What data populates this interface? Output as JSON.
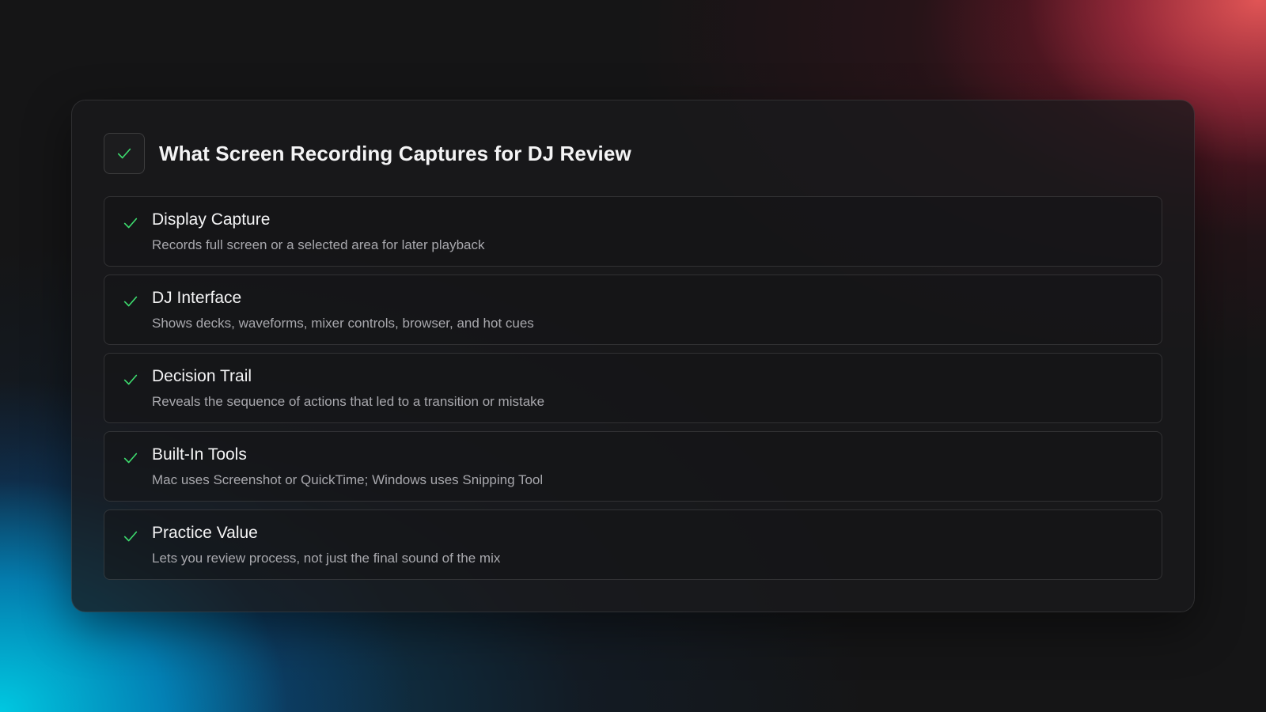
{
  "card": {
    "title": "What Screen Recording Captures for DJ Review",
    "header_icon": "check-icon",
    "accent_color": "#3ddc6e"
  },
  "items": [
    {
      "title": "Display Capture",
      "description": "Records full screen or a selected area for later playback",
      "icon": "check-icon"
    },
    {
      "title": "DJ Interface",
      "description": "Shows decks, waveforms, mixer controls, browser, and hot cues",
      "icon": "check-icon"
    },
    {
      "title": "Decision Trail",
      "description": "Reveals the sequence of actions that led to a transition or mistake",
      "icon": "check-icon"
    },
    {
      "title": "Built-In Tools",
      "description": "Mac uses Screenshot or QuickTime; Windows uses Snipping Tool",
      "icon": "check-icon"
    },
    {
      "title": "Practice Value",
      "description": "Lets you review process, not just the final sound of the mix",
      "icon": "check-icon"
    }
  ]
}
